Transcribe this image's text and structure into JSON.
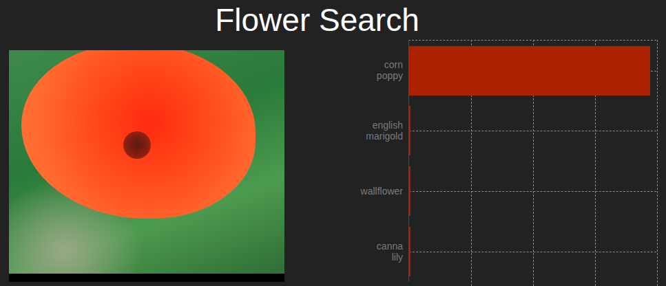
{
  "title": "Flower Search",
  "chart": {
    "max": 1,
    "categories": [
      {
        "label": "corn poppy",
        "value": 0.975
      },
      {
        "label": "english marigold",
        "value": 0.004
      },
      {
        "label": "wallflower",
        "value": 0.003
      },
      {
        "label": "canna lily",
        "value": 0.002
      }
    ]
  }
}
